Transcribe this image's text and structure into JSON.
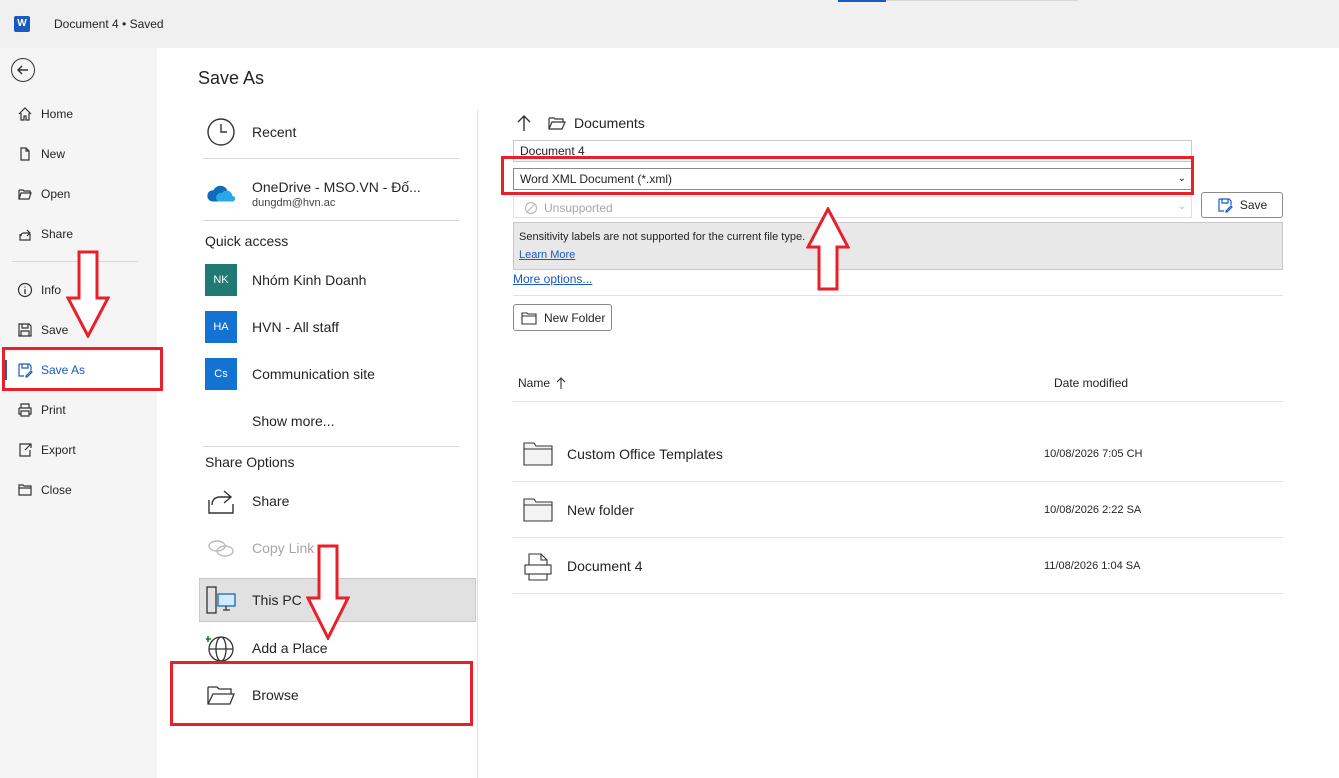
{
  "titlebar": {
    "logo": "W",
    "doc_title": "Document 4 • Saved"
  },
  "leftnav": {
    "items": [
      {
        "label": "Home",
        "icon": "home-icon"
      },
      {
        "label": "New",
        "icon": "new-file-icon"
      },
      {
        "label": "Open",
        "icon": "folder-open-icon"
      },
      {
        "label": "Share",
        "icon": "share-icon"
      },
      {
        "label": "Info",
        "icon": "info-icon"
      },
      {
        "label": "Save",
        "icon": "save-icon"
      },
      {
        "label": "Save As",
        "icon": "save-as-icon"
      },
      {
        "label": "Print",
        "icon": "print-icon"
      },
      {
        "label": "Export",
        "icon": "export-icon"
      },
      {
        "label": "Close",
        "icon": "folder-close-icon"
      }
    ]
  },
  "main": {
    "title": "Save As",
    "locations": {
      "recent": "Recent",
      "onedrive_name": "OneDrive - MSO.VN - Đố...",
      "onedrive_email": "dungdm@hvn.ac",
      "quick_access": "Quick access",
      "quick_items": [
        {
          "label": "Nhóm Kinh Doanh",
          "initials": "NK",
          "color": "#1f7a73"
        },
        {
          "label": "HVN - All staff",
          "initials": "HA",
          "color": "#1473d2"
        },
        {
          "label": "Communication site",
          "initials": "Cs",
          "color": "#1473d2"
        }
      ],
      "show_more": "Show more...",
      "share_options": "Share Options",
      "share": "Share",
      "copy_link": "Copy Link",
      "this_pc": "This PC",
      "add_place": "Add a Place",
      "browse": "Browse"
    },
    "save_panel": {
      "path": "Documents",
      "filename": "Document 4",
      "file_type": "Word XML Document (*.xml)",
      "sensitivity": "Unsupported",
      "save_button": "Save",
      "info_text": "Sensitivity labels are not supported for the current file type.",
      "learn_more": "Learn More",
      "more_options": "More options...",
      "new_folder": "New Folder",
      "col_name": "Name",
      "col_date": "Date modified",
      "files": [
        {
          "name": "Custom Office Templates",
          "date": "10/08/2026 7:05 CH",
          "type": "folder"
        },
        {
          "name": "New folder",
          "date": "10/08/2026 2:22 SA",
          "type": "folder"
        },
        {
          "name": "Document 4",
          "date": "11/08/2026 1:04 SA",
          "type": "document"
        }
      ]
    }
  }
}
